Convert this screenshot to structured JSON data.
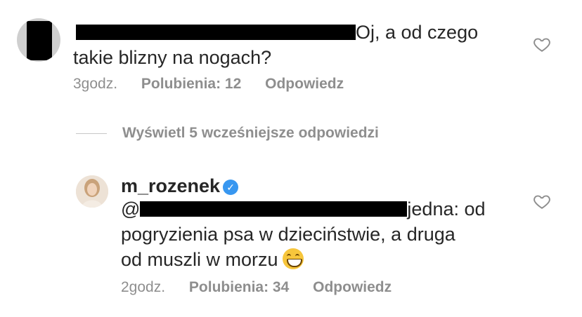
{
  "comments": [
    {
      "text_after_redaction": "Oj, a od czego",
      "text_line2": "takie blizny na nogach?",
      "time": "3godz.",
      "likes": "Polubienia: 12",
      "reply": "Odpowiedz"
    },
    {
      "username": "m_rozenek",
      "mention_prefix": "@",
      "text_after_redaction": "jedna: od",
      "text_line2": "pogryzienia psa w dzieciństwie, a druga",
      "text_line3": "od muszli w morzu",
      "time": "2godz.",
      "likes": "Polubienia: 34",
      "reply": "Odpowiedz"
    }
  ],
  "view_replies": "Wyświetl 5 wcześniejsze odpowiedzi",
  "icons": {
    "verified": "verified-badge-icon",
    "heart": "heart-icon",
    "emoji": "grinning-face-emoji"
  },
  "colors": {
    "text": "#262626",
    "meta": "#8e8e8e",
    "verified": "#3897f0"
  }
}
